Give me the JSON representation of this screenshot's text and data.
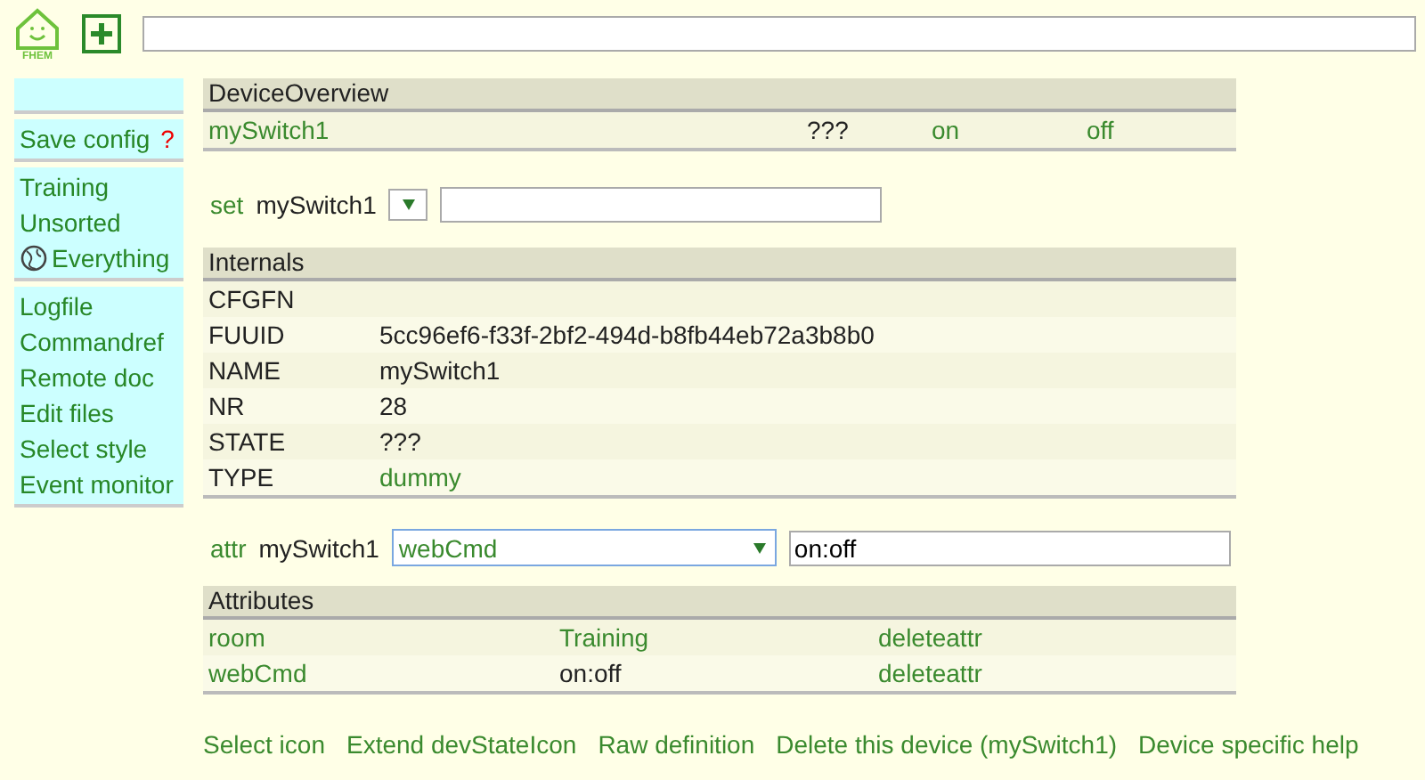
{
  "header": {
    "logo_text": "FHEM"
  },
  "sidebar": {
    "groups": [
      {
        "kind": "blank"
      },
      {
        "items": [
          {
            "label": "Save config",
            "badge": "?",
            "has_icon": false
          }
        ]
      },
      {
        "items": [
          {
            "label": "Training",
            "has_icon": false
          },
          {
            "label": "Unsorted",
            "has_icon": false
          },
          {
            "label": "Everything",
            "has_icon": true
          }
        ]
      },
      {
        "items": [
          {
            "label": "Logfile",
            "has_icon": false
          },
          {
            "label": "Commandref",
            "has_icon": false
          },
          {
            "label": "Remote doc",
            "has_icon": false
          },
          {
            "label": "Edit files",
            "has_icon": false
          },
          {
            "label": "Select style",
            "has_icon": false
          },
          {
            "label": "Event monitor",
            "has_icon": false
          }
        ]
      }
    ]
  },
  "device_overview": {
    "title": "DeviceOverview",
    "name": "mySwitch1",
    "state": "???",
    "commands": [
      "on",
      "off"
    ]
  },
  "set_line": {
    "label": "set",
    "device": "mySwitch1"
  },
  "internals": {
    "title": "Internals",
    "rows": [
      {
        "name": "CFGFN"
      },
      {
        "name": "FUUID",
        "value": "5cc96ef6-f33f-2bf2-494d-b8fb44eb72a3b8b0"
      },
      {
        "name": "NAME",
        "value": "mySwitch1"
      },
      {
        "name": "NR",
        "value": "28"
      },
      {
        "name": "STATE",
        "value": "???"
      },
      {
        "name": "TYPE",
        "value": "dummy",
        "linked": true
      }
    ]
  },
  "attr_line": {
    "label": "attr",
    "device": "mySwitch1",
    "select_value": "webCmd",
    "focused": true,
    "input_value": "on:off"
  },
  "attributes": {
    "title": "Attributes",
    "rows": [
      {
        "name": "room",
        "value": "Training",
        "linked": true,
        "action": "deleteattr"
      },
      {
        "name": "webCmd",
        "value": "on:off",
        "linked": false,
        "action": "deleteattr"
      }
    ]
  },
  "footer_links": [
    "Select icon",
    "Extend devStateIcon",
    "Raw definition",
    "Delete this device (mySwitch1)",
    "Device specific help"
  ]
}
